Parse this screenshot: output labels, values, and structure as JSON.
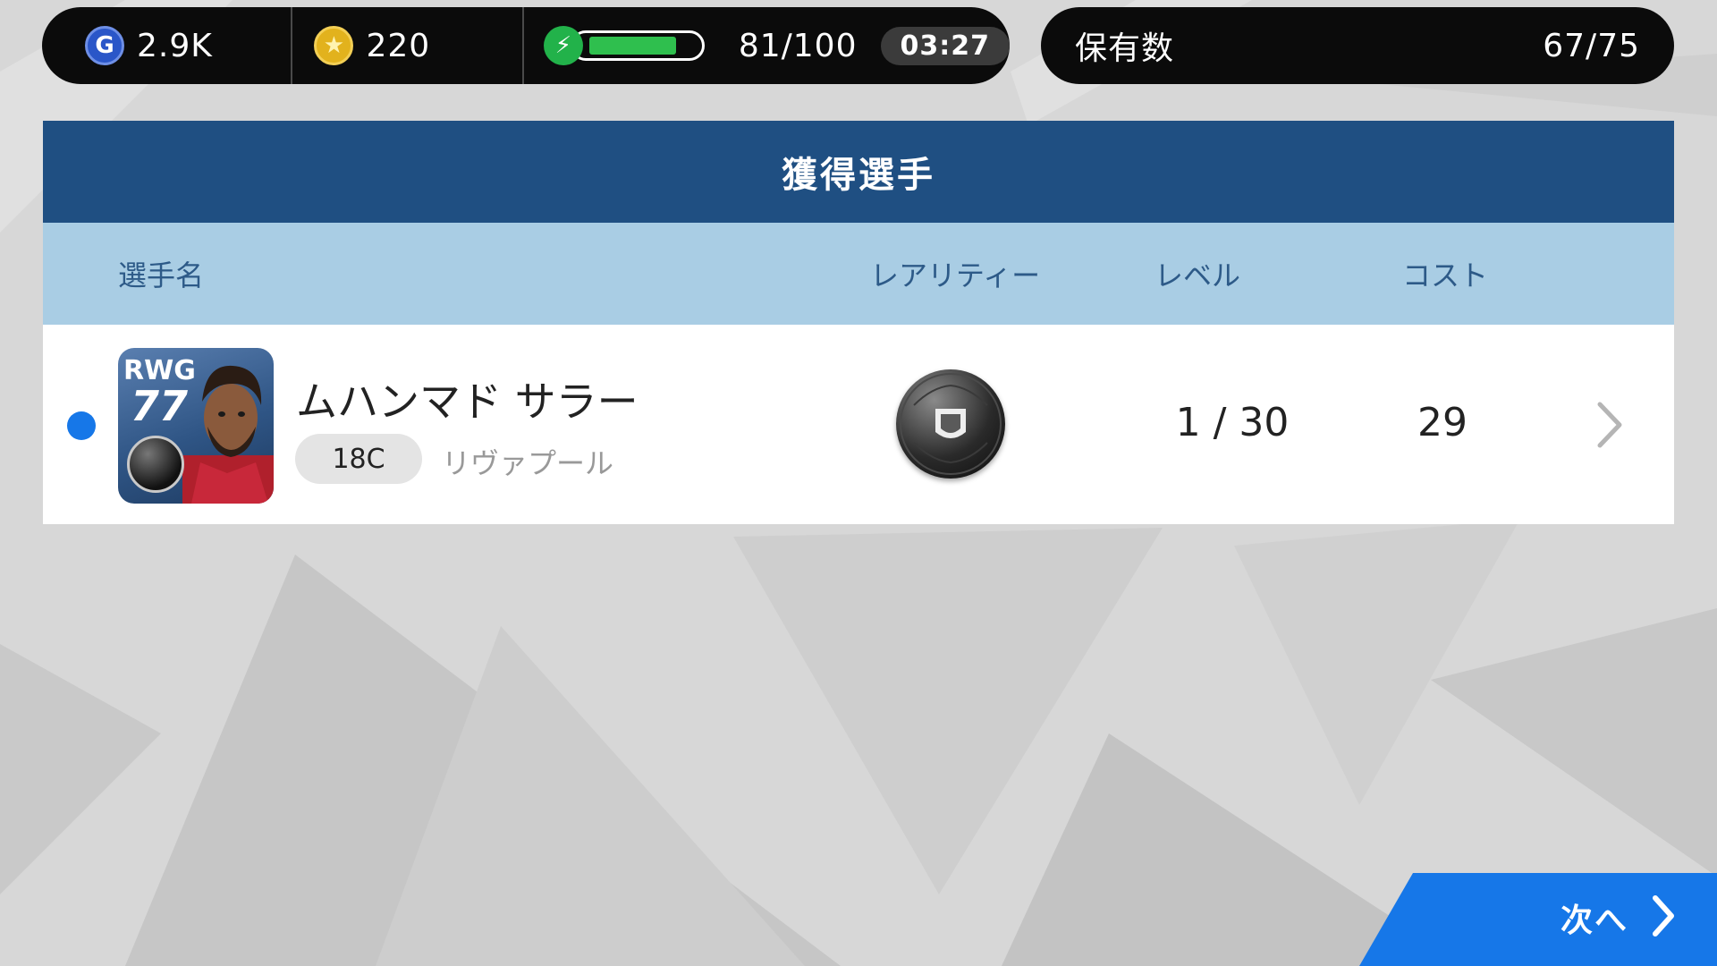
{
  "status_bar": {
    "gp": {
      "icon": "g-icon",
      "letter": "G",
      "value": "2.9K"
    },
    "coins": {
      "icon": "coin-icon",
      "letter": "★",
      "value": "220"
    },
    "stamina": {
      "icon": "bolt-icon",
      "glyph": "⚡",
      "count": "81/100",
      "fill_ratio": 0.81,
      "timer": "03:27"
    },
    "owned": {
      "label": "保有数",
      "value": "67/75"
    }
  },
  "panel": {
    "title": "獲得選手",
    "columns": {
      "name": "選手名",
      "rarity": "レアリティー",
      "level": "レベル",
      "cost": "コスト"
    },
    "players": [
      {
        "position": "RWG",
        "rating": "77",
        "name": "ムハンマド サラー",
        "age_badge": "18C",
        "club": "リヴァプール",
        "rarity_icon": "black-ball-icon",
        "level": "1 / 30",
        "cost": "29",
        "is_new": true
      }
    ]
  },
  "next_button": {
    "label": "次へ"
  },
  "colors": {
    "title_bar": "#1f4f82",
    "header_bar": "#a9cde4",
    "accent_blue": "#1677e8",
    "stamina_green": "#2fbf4e"
  }
}
